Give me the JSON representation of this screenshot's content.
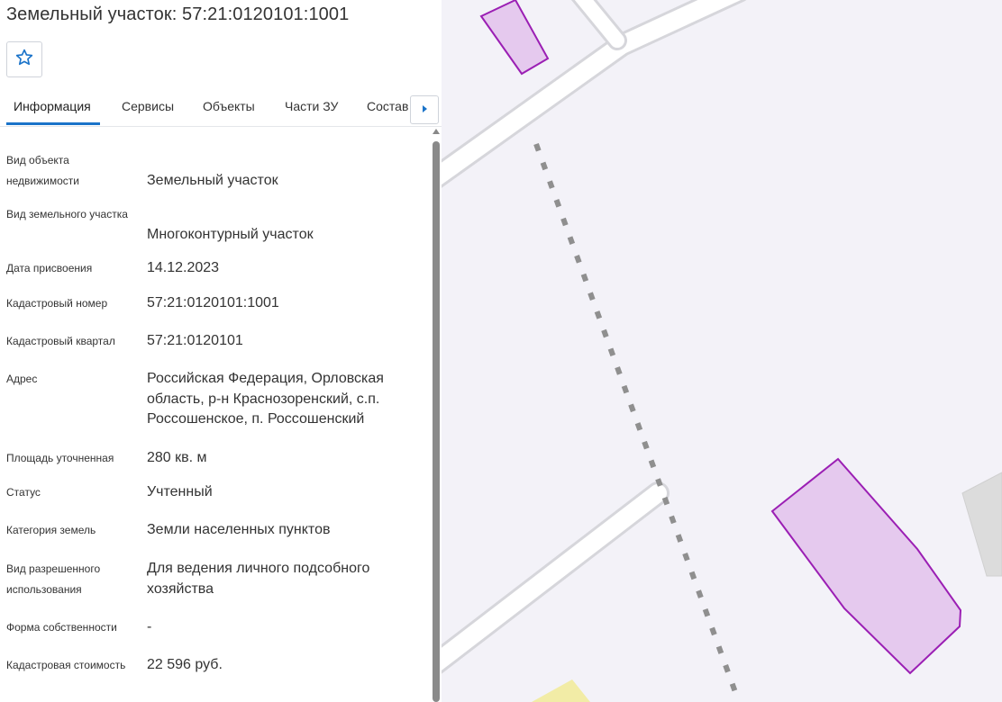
{
  "header": {
    "title": "Земельный участок: 57:21:0120101:1001"
  },
  "toolbar": {
    "favorite_icon": "star-outline-icon",
    "accent_color": "#1a73c9"
  },
  "tabs": [
    {
      "label": "Информация",
      "active": true
    },
    {
      "label": "Сервисы",
      "active": false
    },
    {
      "label": "Объекты",
      "active": false
    },
    {
      "label": "Части ЗУ",
      "active": false
    },
    {
      "label": "Состав",
      "active": false
    }
  ],
  "tabs_next_icon": "caret-right-icon",
  "info": {
    "rows": [
      {
        "label": "Вид объекта недвижимости",
        "value": "Земельный участок"
      },
      {
        "label": "Вид земельного участка",
        "value": "Многоконтурный участок"
      },
      {
        "label": "Дата присвоения",
        "value": "14.12.2023"
      },
      {
        "label": "Кадастровый номер",
        "value": "57:21:0120101:1001"
      },
      {
        "label": "Кадастровый квартал",
        "value": "57:21:0120101"
      },
      {
        "label": "Адрес",
        "value": "Российская Федерация, Орловская область, р-н Краснозоренский, с.п. Россошенское, п. Россошенский"
      },
      {
        "label": "Площадь уточненная",
        "value": "280 кв. м"
      },
      {
        "label": "Статус",
        "value": "Учтенный"
      },
      {
        "label": "Категория земель",
        "value": "Земли населенных пунктов"
      },
      {
        "label": "Вид разрешенного использования",
        "value": "Для ведения личного подсобного хозяйства"
      },
      {
        "label": "Форма собственности",
        "value": "-"
      },
      {
        "label": "Кадастровая стоимость",
        "value": "22 596 руб."
      }
    ]
  },
  "map": {
    "background_color": "#f3f2f8",
    "road_color": "#ffffff",
    "road_edge_color": "#d6d6db",
    "parcel_fill": "#e5c9ee",
    "parcel_stroke": "#9b1fb4",
    "railway_color": "#8a8a8a",
    "building_color": "#dcdcdc",
    "yellow_area_color": "#f2eca6"
  }
}
